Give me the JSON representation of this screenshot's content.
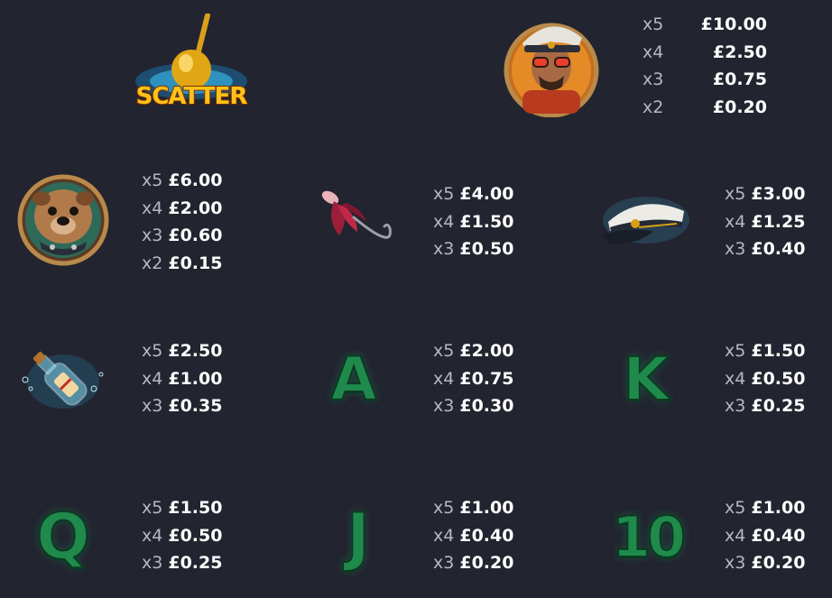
{
  "symbols": {
    "scatter": {
      "label": "SCATTER",
      "icon": "float-bobber-icon"
    },
    "captain": {
      "icon": "captain-icon",
      "pays": [
        {
          "mult": "x5",
          "amount": "£10.00"
        },
        {
          "mult": "x4",
          "amount": "£2.50"
        },
        {
          "mult": "x3",
          "amount": "£0.75"
        },
        {
          "mult": "x2",
          "amount": "£0.20"
        }
      ]
    },
    "bulldog": {
      "icon": "bulldog-icon",
      "pays": [
        {
          "mult": "x5",
          "amount": "£6.00"
        },
        {
          "mult": "x4",
          "amount": "£2.00"
        },
        {
          "mult": "x3",
          "amount": "£0.60"
        },
        {
          "mult": "x2",
          "amount": "£0.15"
        }
      ]
    },
    "lure": {
      "icon": "fishing-lure-icon",
      "pays": [
        {
          "mult": "x5",
          "amount": "£4.00"
        },
        {
          "mult": "x4",
          "amount": "£1.50"
        },
        {
          "mult": "x3",
          "amount": "£0.50"
        }
      ]
    },
    "cap": {
      "icon": "captain-hat-icon",
      "pays": [
        {
          "mult": "x5",
          "amount": "£3.00"
        },
        {
          "mult": "x4",
          "amount": "£1.25"
        },
        {
          "mult": "x3",
          "amount": "£0.40"
        }
      ]
    },
    "bottle": {
      "icon": "message-bottle-icon",
      "pays": [
        {
          "mult": "x5",
          "amount": "£2.50"
        },
        {
          "mult": "x4",
          "amount": "£1.00"
        },
        {
          "mult": "x3",
          "amount": "£0.35"
        }
      ]
    },
    "a": {
      "letter": "A",
      "pays": [
        {
          "mult": "x5",
          "amount": "£2.00"
        },
        {
          "mult": "x4",
          "amount": "£0.75"
        },
        {
          "mult": "x3",
          "amount": "£0.30"
        }
      ]
    },
    "k": {
      "letter": "K",
      "pays": [
        {
          "mult": "x5",
          "amount": "£1.50"
        },
        {
          "mult": "x4",
          "amount": "£0.50"
        },
        {
          "mult": "x3",
          "amount": "£0.25"
        }
      ]
    },
    "q": {
      "letter": "Q",
      "pays": [
        {
          "mult": "x5",
          "amount": "£1.50"
        },
        {
          "mult": "x4",
          "amount": "£0.50"
        },
        {
          "mult": "x3",
          "amount": "£0.25"
        }
      ]
    },
    "j": {
      "letter": "J",
      "pays": [
        {
          "mult": "x5",
          "amount": "£1.00"
        },
        {
          "mult": "x4",
          "amount": "£0.40"
        },
        {
          "mult": "x3",
          "amount": "£0.20"
        }
      ]
    },
    "ten": {
      "letter": "10",
      "pays": [
        {
          "mult": "x5",
          "amount": "£1.00"
        },
        {
          "mult": "x4",
          "amount": "£0.40"
        },
        {
          "mult": "x3",
          "amount": "£0.20"
        }
      ]
    }
  },
  "colors": {
    "background": "#22242f",
    "multiplier": "#b7b8c0",
    "amount": "#ffffff",
    "letter_green": "#1f8a4c",
    "scatter_gold": "#ffc21a"
  }
}
